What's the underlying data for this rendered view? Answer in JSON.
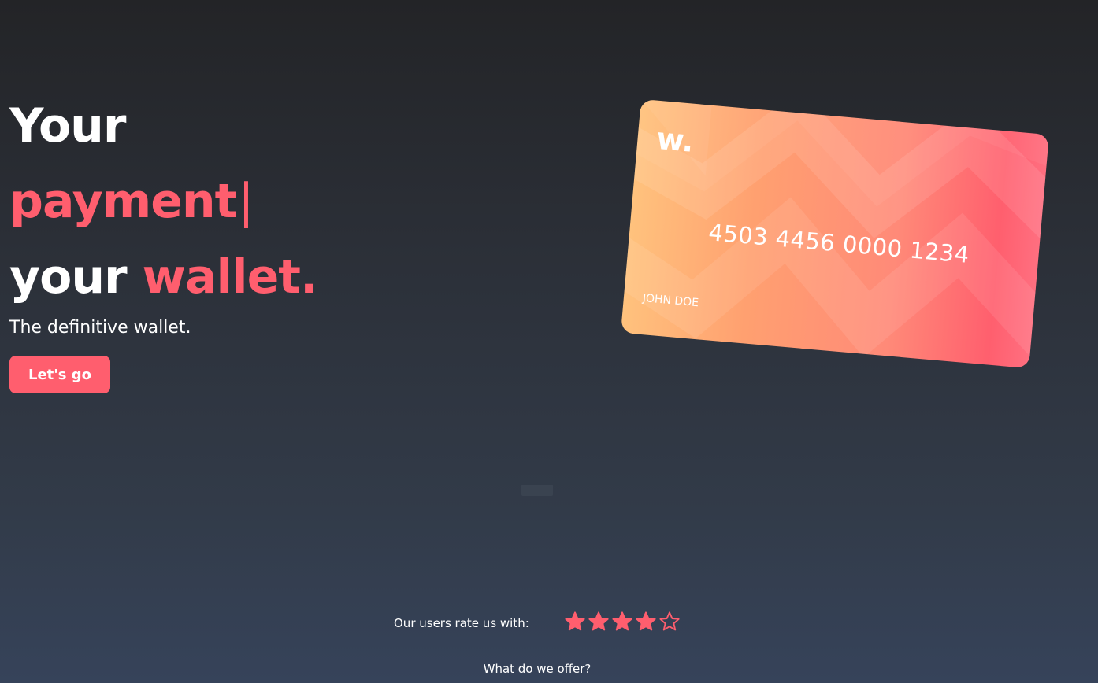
{
  "hero": {
    "line1": "Your",
    "line2_typed": "payment",
    "cursor": "|",
    "line3_white": "your",
    "line3_accent": "wallet.",
    "tagline": "The definitive wallet.",
    "cta_label": "Let's go"
  },
  "card": {
    "logo": "w.",
    "number": "4503 4456 0000 1234",
    "holder": "JOHN DOE",
    "gradient_colors": [
      "#ffc27d",
      "#ffa070",
      "#ff8a78",
      "#ff5f6e",
      "#ff6f80"
    ]
  },
  "rating": {
    "label": "Our users rate us with:",
    "value": 4,
    "max": 5,
    "star_color": "#ff5e6e"
  },
  "offer": {
    "heading": "What do we offer?"
  },
  "colors": {
    "accent": "#ff5e6e",
    "background_top": "#232427",
    "background_bottom": "#36435a"
  }
}
